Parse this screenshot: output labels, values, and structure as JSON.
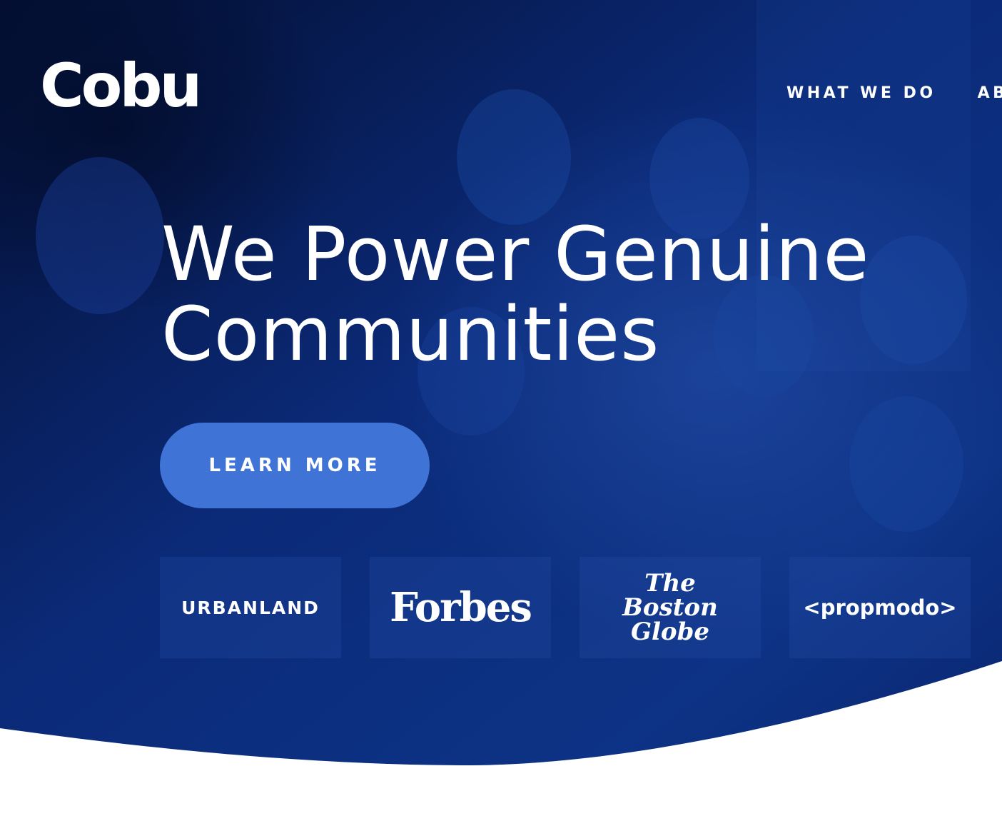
{
  "brand": {
    "logo": "Cobu"
  },
  "nav": {
    "items": [
      "WHAT WE DO",
      "AB"
    ]
  },
  "hero": {
    "headline": "We Power Genuine Communities",
    "cta_label": "LEARN MORE"
  },
  "press": {
    "logos": [
      "URBANLAND",
      "Forbes",
      "The\nBoston\nGlobe",
      "<propmodo>"
    ]
  },
  "colors": {
    "hero_dark": "#06174a",
    "hero_blue": "#0c2d80",
    "accent": "#3f74d6",
    "background": "#ffffff"
  }
}
